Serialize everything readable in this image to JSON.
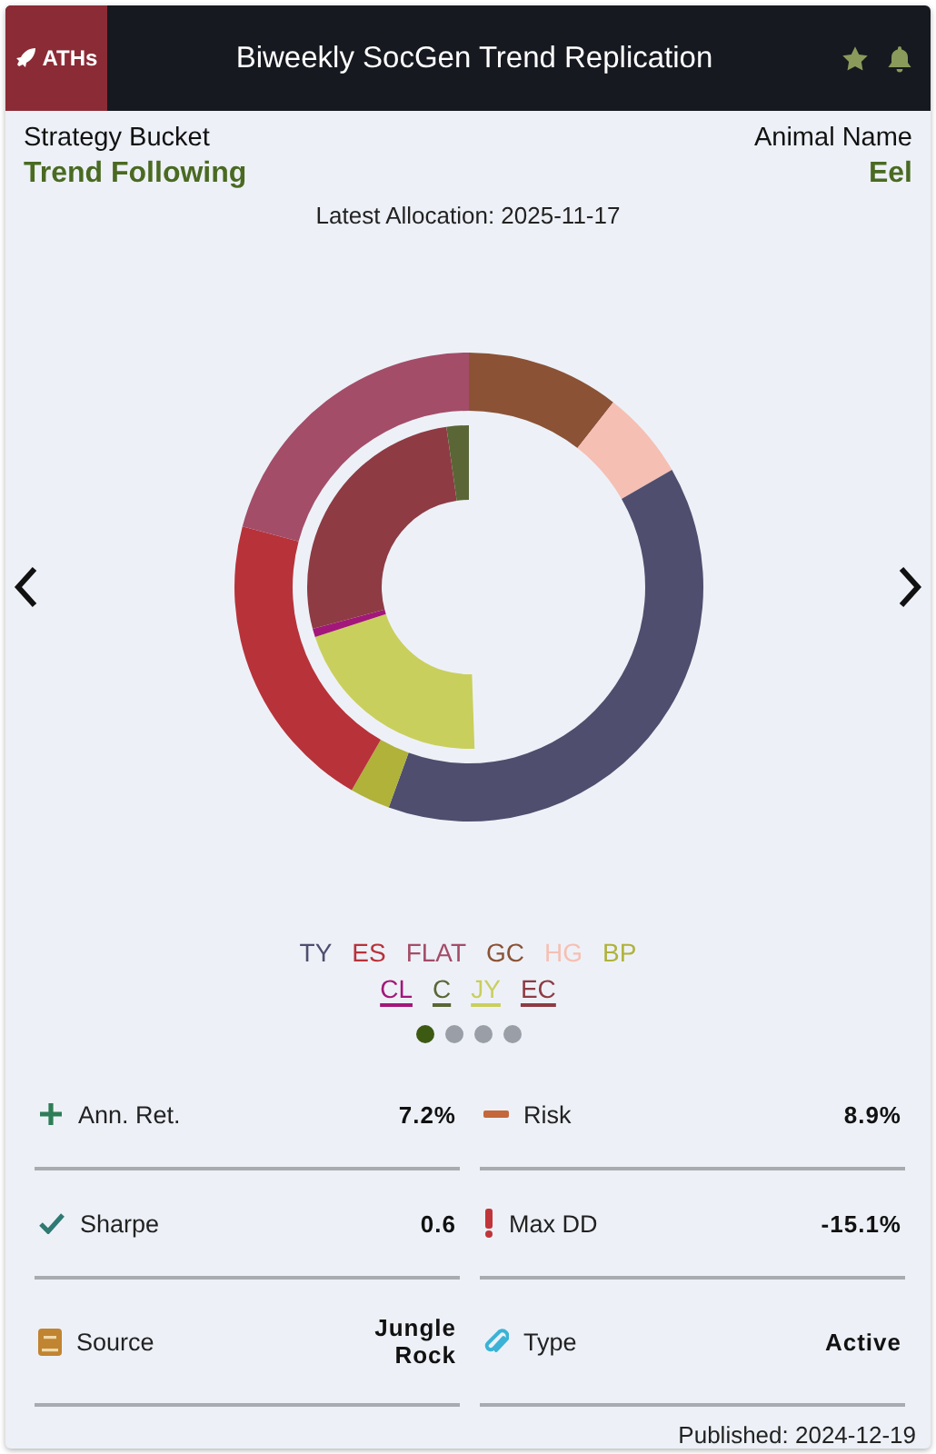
{
  "header": {
    "badge": "ATHs",
    "title": "Biweekly SocGen Trend Replication"
  },
  "info": {
    "left_label": "Strategy Bucket",
    "left_value": "Trend Following",
    "right_label": "Animal Name",
    "right_value": "Eel"
  },
  "allocation": "Latest Allocation: 2025-11-17",
  "legend": [
    {
      "label": "TY",
      "color": "#4f4e6e",
      "underlined": false
    },
    {
      "label": "ES",
      "color": "#b8323a",
      "underlined": false
    },
    {
      "label": "FLAT",
      "color": "#a34d68",
      "underlined": false
    },
    {
      "label": "GC",
      "color": "#8b5236",
      "underlined": false
    },
    {
      "label": "HG",
      "color": "#f6bfb3",
      "underlined": false
    },
    {
      "label": "BP",
      "color": "#b0b23a",
      "underlined": false
    },
    {
      "label": "CL",
      "color": "#a3177a",
      "underlined": true
    },
    {
      "label": "C",
      "color": "#5b6636",
      "underlined": true
    },
    {
      "label": "JY",
      "color": "#c9cf5c",
      "underlined": true
    },
    {
      "label": "EC",
      "color": "#8e3b44",
      "underlined": true
    }
  ],
  "pager": [
    {
      "selected": true
    },
    {
      "selected": false
    },
    {
      "selected": false
    },
    {
      "selected": false
    }
  ],
  "stats": [
    {
      "kind": "plus",
      "label": "Ann. Ret.",
      "value": "7.2%"
    },
    {
      "kind": "minus",
      "label": "Risk",
      "value": "8.9%"
    },
    {
      "kind": "check",
      "label": "Sharpe",
      "value": "0.6"
    },
    {
      "kind": "alert",
      "label": "Max DD",
      "value": "-15.1%"
    },
    {
      "kind": "book",
      "label": "Source",
      "value": "Jungle Rock"
    },
    {
      "kind": "clip",
      "label": "Type",
      "value": "Active"
    }
  ],
  "published": "Published: 2024-12-19"
}
